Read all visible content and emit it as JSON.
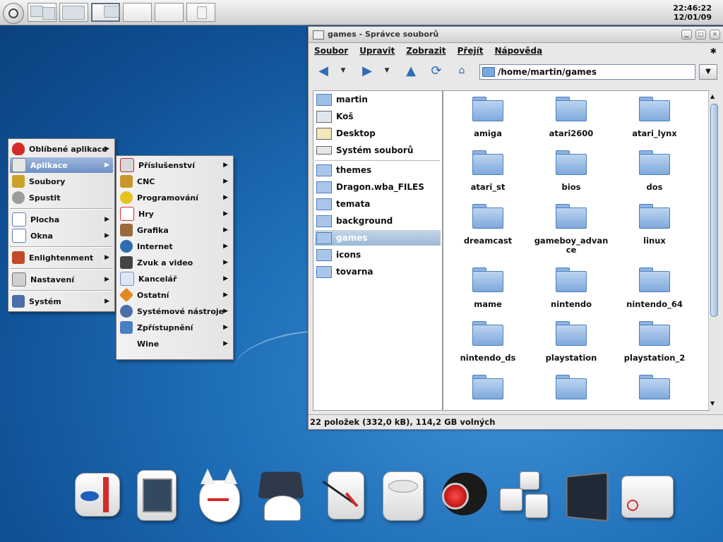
{
  "top_panel": {
    "clock_time": "22:46:22",
    "clock_date": "12/01/09",
    "pager_count": 6,
    "active_desktop": 3
  },
  "main_menu": {
    "items": [
      {
        "label": "Oblíbené aplikace",
        "icon": "heart-icon",
        "color": "#d62a2a"
      },
      {
        "label": "Aplikace",
        "icon": "applications-icon",
        "color": "#6f8fc4",
        "highlighted": true
      },
      {
        "label": "Soubory",
        "icon": "files-icon",
        "color": "#c9a227"
      },
      {
        "label": "Spustit",
        "icon": "run-gear-icon",
        "color": "#8c8c8c"
      },
      {
        "label": "Plocha",
        "icon": "desktop-icon",
        "color": "#5b7fb5"
      },
      {
        "label": "Okna",
        "icon": "windows-icon",
        "color": "#5b7fb5"
      },
      {
        "label": "Enlightenment",
        "icon": "enlightenment-icon",
        "color": "#c04a2a"
      },
      {
        "label": "Nastavení",
        "icon": "settings-icon",
        "color": "#7a7a7a"
      },
      {
        "label": "Systém",
        "icon": "system-icon",
        "color": "#4a6fa8"
      }
    ]
  },
  "sub_menu": {
    "items": [
      {
        "label": "Příslušenství",
        "icon": "accessories-icon",
        "color": "#b03030"
      },
      {
        "label": "CNC",
        "icon": "cnc-icon",
        "color": "#c9962c"
      },
      {
        "label": "Programování",
        "icon": "programming-icon",
        "color": "#e6c21f"
      },
      {
        "label": "Hry",
        "icon": "cards-icon",
        "color": "#d63030"
      },
      {
        "label": "Grafika",
        "icon": "brush-icon",
        "color": "#9a6a3a"
      },
      {
        "label": "Internet",
        "icon": "globe-icon",
        "color": "#2f6db3"
      },
      {
        "label": "Zvuk a video",
        "icon": "clapper-icon",
        "color": "#444444"
      },
      {
        "label": "Kancelář",
        "icon": "office-icon",
        "color": "#6f8fc4"
      },
      {
        "label": "Ostatní",
        "icon": "other-icon",
        "color": "#e08a1f"
      },
      {
        "label": "Systémové nástroje",
        "icon": "system-tools-icon",
        "color": "#4a6fa8"
      },
      {
        "label": "Zpřístupnění",
        "icon": "accessibility-icon",
        "color": "#4a7fc4"
      },
      {
        "label": "Wine",
        "icon": "",
        "color": ""
      }
    ]
  },
  "window": {
    "title": "games - Správce souborů",
    "menubar": [
      "Soubor",
      "Upravit",
      "Zobrazit",
      "Přejít",
      "Nápověda"
    ],
    "location": "/home/martin/games",
    "side_places": [
      {
        "label": "martin",
        "icon": "home-folder-icon"
      },
      {
        "label": "Koš",
        "icon": "trash-icon"
      },
      {
        "label": "Desktop",
        "icon": "desktop-folder-icon"
      },
      {
        "label": "Systém souborů",
        "icon": "drive-icon"
      }
    ],
    "side_bookmarks": [
      {
        "label": "themes"
      },
      {
        "label": "Dragon.wba_FILES"
      },
      {
        "label": "temata"
      },
      {
        "label": "background"
      },
      {
        "label": "games",
        "selected": true
      },
      {
        "label": "icons"
      },
      {
        "label": "tovarna"
      }
    ],
    "files": [
      "amiga",
      "atari2600",
      "atari_lynx",
      "atari_st",
      "bios",
      "dos",
      "dreamcast",
      "gameboy_advance",
      "linux",
      "mame",
      "nintendo",
      "nintendo_64",
      "nintendo_ds",
      "playstation",
      "playstation_2",
      "",
      "",
      ""
    ],
    "status": "22 položek (332,0 kB), 114,2 GB volných"
  },
  "dock": {
    "items": [
      "scanner-app-icon",
      "monitor-app-icon",
      "fox-mask-app-icon",
      "pie-lamp-app-icon",
      "clock-app-icon",
      "media-player-app-icon",
      "webcam-app-icon",
      "cubes-app-icon",
      "terminal-app-icon",
      "drive-app-icon"
    ]
  }
}
